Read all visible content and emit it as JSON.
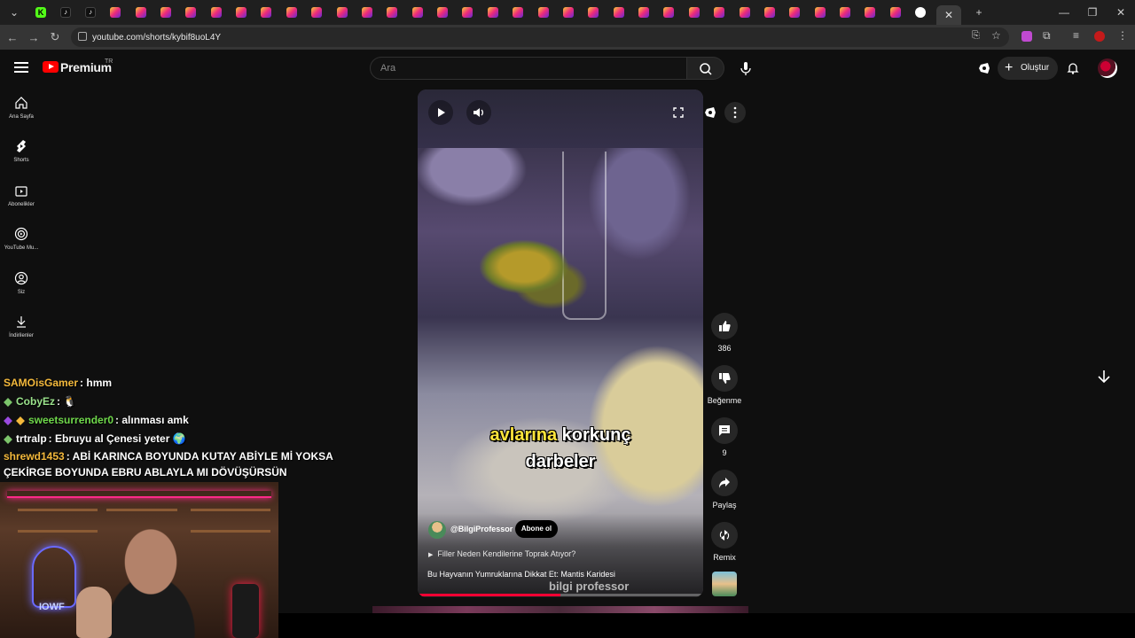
{
  "browser": {
    "url": "youtube.com/shorts/kybif8uoL4Y",
    "tab_count_icons": [
      "kick-icon",
      "tiktok-icon",
      "tiktok-icon",
      "instagram-icon",
      "instagram-icon",
      "instagram-icon",
      "instagram-icon",
      "instagram-icon",
      "instagram-icon",
      "instagram-icon",
      "instagram-icon",
      "instagram-icon",
      "instagram-icon",
      "instagram-icon",
      "instagram-icon",
      "instagram-icon",
      "instagram-icon",
      "instagram-icon",
      "instagram-icon",
      "instagram-icon",
      "instagram-icon",
      "instagram-icon",
      "instagram-icon",
      "instagram-icon",
      "instagram-icon",
      "instagram-icon",
      "instagram-icon",
      "instagram-icon",
      "instagram-icon",
      "instagram-icon",
      "instagram-icon",
      "instagram-icon",
      "instagram-icon",
      "instagram-icon",
      "instagram-icon",
      "google-icon"
    ],
    "active_tab_close": "✕",
    "new_tab": "+"
  },
  "header": {
    "brand": "Premium",
    "country": "TR",
    "search_placeholder": "Ara",
    "create_label": "Oluştur"
  },
  "sidebar": {
    "items": [
      {
        "label": "Ana Sayfa",
        "icon": "home-icon"
      },
      {
        "label": "Shorts",
        "icon": "shorts-icon"
      },
      {
        "label": "Abonelikler",
        "icon": "subscriptions-icon"
      },
      {
        "label": "YouTube Mu...",
        "icon": "youtube-music-icon"
      },
      {
        "label": "Siz",
        "icon": "you-icon"
      },
      {
        "label": "İndirilenler",
        "icon": "download-icon"
      }
    ]
  },
  "chat": {
    "messages": [
      {
        "user": "SAMOisGamer",
        "text": ": hmm",
        "color": "#f4b93c"
      },
      {
        "user": "CobyEz",
        "text": ": 🐧",
        "color": "#9be38c"
      },
      {
        "user": "sweetsurrender0",
        "text": ": alınması amk",
        "color": "#6fd84b"
      },
      {
        "user": "trtralp",
        "text": ": Ebruyu al Çenesi yeter 🌍",
        "color": "#ffffff"
      },
      {
        "user": "shrewd1453",
        "text": ": ABİ KARINCA BOYUNDA KUTAY ABİYLE Mİ YOKSA",
        "color": "#f4b93c"
      }
    ],
    "continuation": "ÇEKİRGE BOYUNDA EBRU ABLAYLA MI DÖVÜŞÜRSÜN"
  },
  "webcam": {
    "neon_text": "IOWF"
  },
  "video": {
    "caption_highlight": "avlarına",
    "caption_rest": " korkunç",
    "caption_line2": "darbeler",
    "channel": "@BilgiProfessor",
    "subscribe": "Abone ol",
    "related": "Filler Neden Kendilerine Toprak Atıyor?",
    "title": "Bu Hayvanın Yumruklarına Dikkat Et: Mantis Karidesi",
    "watermark": "bilgi professor",
    "progress": 0.5
  },
  "actions": {
    "likes": "386",
    "dislike": "Beğenme",
    "comments": "9",
    "share": "Paylaş",
    "remix": "Remix"
  }
}
